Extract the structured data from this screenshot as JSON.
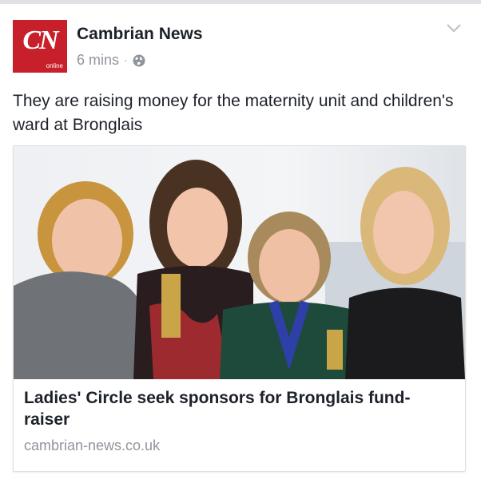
{
  "post": {
    "page_name": "Cambrian News",
    "avatar_monogram": "CN",
    "avatar_sub_label": "online",
    "timestamp": "6 mins",
    "separator": "·",
    "privacy_icon": "globe-icon",
    "options_icon": "chevron-down-icon",
    "text": "They are raising money for the maternity unit and children's ward at Bronglais"
  },
  "link_card": {
    "image_description": "photo of four women holding chains of office",
    "headline": "Ladies' Circle seek sponsors for Bronglais fund-raiser",
    "domain": "cambrian-news.co.uk"
  },
  "colors": {
    "brand_red": "#c8202a",
    "secondary_text": "#90949c",
    "primary_text": "#1d2129",
    "border": "#dddfe2"
  }
}
